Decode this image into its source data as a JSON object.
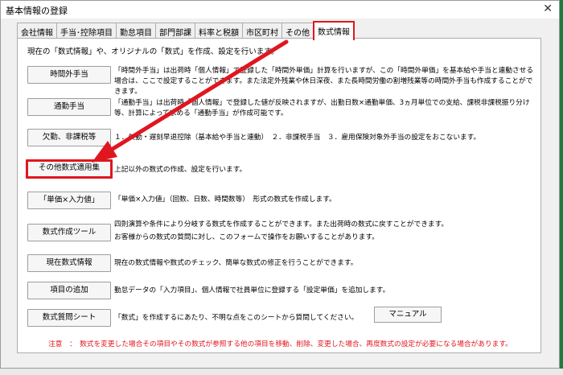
{
  "window": {
    "title": "基本情報の登録",
    "close": "✕"
  },
  "tabs": [
    {
      "label": "会社情報"
    },
    {
      "label": "手当･控除項目"
    },
    {
      "label": "勤怠項目"
    },
    {
      "label": "部門部課"
    },
    {
      "label": "料率と税額"
    },
    {
      "label": "市区町村"
    },
    {
      "label": "その他"
    },
    {
      "label": "数式情報"
    }
  ],
  "panel": {
    "intro": "現在の「数式情報」や、オリジナルの「数式」を作成、設定を行います。",
    "rows": [
      {
        "button": "時間外手当",
        "desc": "「時間外手当」は出荷時「個人情報」で登録した「時間外単価」計算を行いますが、この「時間外単価」を基本給や手当と連動させる場合は、ここで設定することができます。また法定外残業や休日深夜、また長時間労働の割増残業等の時間外手当も作成することができます。"
      },
      {
        "button": "通勤手当",
        "desc": "「通勤手当」は出荷時「個人情報」で登録した値が反映されますが、出勤日数×通勤単価、3ヵ月単位での支給、課税非課税振り分け等、計算によって求める「通勤手当」が作成可能です。"
      },
      {
        "button": "欠勤、非課税等",
        "desc": "１．欠勤・遅刻早退控除（基本給や手当と連動）　２．非課税手当　３．雇用保険対象外手当の設定をおこないます。"
      },
      {
        "button": "その他数式適用集",
        "desc": "上記以外の数式の作成、設定を行います。"
      },
      {
        "button": "「単価×入力値」",
        "desc": "「単価×入力値」（回数、日数、時間数等）　形式の数式を作成します。"
      },
      {
        "button": "数式作成ツール",
        "desc": "四則演算や条件により分岐する数式を作成することができます。また出荷時の数式に戻すことができます。\nお客様からの数式の質問に対し、このフォームで操作をお願いすることがあります。"
      },
      {
        "button": "現在数式情報",
        "desc": "現在の数式情報や数式のチェック、簡単な数式の修正を行うことができます。"
      },
      {
        "button": "項目の追加",
        "desc": "勤怠データの「入力項目」、個人情報で社員単位に登録する「設定単価」を追加します。"
      },
      {
        "button": "数式質問シート",
        "desc": "「数式」を作成するにあたり、不明な点をこのシートから質問してください。"
      }
    ],
    "manual_button": "マニュアル",
    "note": "注意　：　数式を変更した場合その項目やその数式が参照する他の項目を移動、削除、変更した場合、再度数式の設定が必要になる場合があります。"
  },
  "colors": {
    "highlight": "#e0161f",
    "desktop": "#2d6a3a"
  }
}
